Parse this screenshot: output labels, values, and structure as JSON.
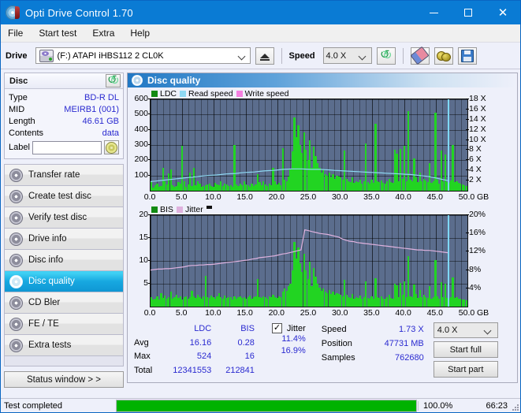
{
  "window": {
    "title": "Opti Drive Control 1.70",
    "icon": "disc-icon",
    "minimize": "minimize-icon",
    "maximize": "maximize-icon",
    "close": "✕"
  },
  "menu": [
    "File",
    "Start test",
    "Extra",
    "Help"
  ],
  "toolbar": {
    "drive_label": "Drive",
    "drive_value": "(F:)  ATAPI iHBS112  2 CL0K",
    "eject_icon": "eject-icon",
    "speed_label": "Speed",
    "speed_value": "4.0 X",
    "refresh_icon": "refresh-icon",
    "eraser_icon": "eraser-icon",
    "plug_icon": "plug-icon",
    "save_icon": "save-icon"
  },
  "disc": {
    "header": "Disc",
    "refresh_icon": "refresh-icon",
    "rows": [
      {
        "key": "Type",
        "value": "BD-R DL"
      },
      {
        "key": "MID",
        "value": "MEIRB1 (001)"
      },
      {
        "key": "Length",
        "value": "46.61 GB"
      },
      {
        "key": "Contents",
        "value": "data"
      }
    ],
    "label_key": "Label",
    "label_value": "",
    "cd_icon": "cd-icon"
  },
  "nav": {
    "items": [
      {
        "label": "Transfer rate",
        "active": false
      },
      {
        "label": "Create test disc",
        "active": false
      },
      {
        "label": "Verify test disc",
        "active": false
      },
      {
        "label": "Drive info",
        "active": false
      },
      {
        "label": "Disc info",
        "active": false
      },
      {
        "label": "Disc quality",
        "active": true
      },
      {
        "label": "CD Bler",
        "active": false
      },
      {
        "label": "FE / TE",
        "active": false
      },
      {
        "label": "Extra tests",
        "active": false
      }
    ],
    "status_button": "Status window > >"
  },
  "panel": {
    "title": "Disc quality",
    "icon": "disc-quality-icon"
  },
  "chart_data": [
    {
      "type": "bar",
      "id": "ldc-chart",
      "title": "",
      "legend": [
        {
          "label": "LDC",
          "color": "#128a12"
        },
        {
          "label": "Read speed",
          "color": "#8ed8f2"
        },
        {
          "label": "Write speed",
          "color": "#f57fe0"
        }
      ],
      "legend_position": "top-left",
      "xlabel": "GB",
      "x": [
        0.0,
        5.0,
        10.0,
        15.0,
        20.0,
        25.0,
        30.0,
        35.0,
        40.0,
        45.0,
        50.0
      ],
      "xlim": [
        0.0,
        50.0
      ],
      "ylabel": "",
      "yticks": [
        100,
        200,
        300,
        400,
        500,
        600
      ],
      "ylim": [
        0,
        600
      ],
      "y2ticks": [
        "2 X",
        "4 X",
        "6 X",
        "8 X",
        "10 X",
        "12 X",
        "14 X",
        "16 X",
        "18 X"
      ],
      "y2lim": [
        0,
        18
      ],
      "grid": true,
      "plot_bgcolor": "#5b6d8d",
      "series": [
        {
          "name": "LDC",
          "color": "#22d422",
          "type": "bar",
          "values": [
            60,
            20,
            35,
            45,
            25,
            30,
            150,
            60,
            40,
            115,
            140,
            35,
            25,
            30,
            55,
            45,
            295,
            60,
            25,
            40,
            120,
            30,
            150,
            35,
            60,
            45,
            25,
            30,
            35,
            40,
            45,
            30,
            25,
            50,
            40,
            35,
            60,
            30,
            45,
            40,
            30,
            35,
            25,
            300,
            40,
            30,
            45,
            35,
            60,
            40,
            35,
            25,
            45,
            30,
            40,
            110,
            55,
            35,
            60,
            40,
            30,
            45,
            35,
            150,
            60,
            40,
            50,
            35,
            280,
            70,
            60,
            95,
            140,
            260,
            480,
            350,
            430,
            300,
            250,
            385,
            270,
            200,
            330,
            150,
            290,
            230,
            180,
            150,
            120,
            140,
            110,
            100,
            120,
            90,
            110,
            80,
            100,
            95,
            90,
            70,
            265,
            80,
            60,
            55,
            90,
            50,
            60,
            55,
            70,
            45,
            60,
            310,
            55,
            45,
            70,
            50,
            440,
            60,
            55,
            65,
            50,
            45,
            60,
            75,
            55,
            50,
            270,
            245,
            60,
            275,
            80,
            295,
            60,
            520,
            70,
            60,
            210,
            90,
            55,
            120,
            60,
            80,
            65,
            55,
            180,
            50,
            60,
            510,
            70,
            45,
            265,
            60,
            240,
            55,
            50,
            65,
            300,
            55,
            60,
            50,
            45,
            40,
            35,
            30
          ]
        },
        {
          "name": "Read speed",
          "color": "#8ed8f2",
          "type": "line",
          "unit": "X",
          "values": [
            1.8,
            1.9,
            2.0,
            2.1,
            2.2,
            2.3,
            2.4,
            2.5,
            2.6,
            2.7,
            2.8,
            2.9,
            3.0,
            3.05,
            3.1,
            3.2,
            3.3,
            3.35,
            3.4,
            3.5,
            3.6,
            3.65,
            3.7,
            3.8,
            3.9,
            3.95,
            4.0,
            4.1,
            4.2,
            4.25,
            4.3,
            4.3,
            4.3,
            4.25,
            4.2,
            4.2,
            4.2,
            4.15,
            4.1,
            4.0,
            3.95,
            3.9,
            3.85,
            3.8,
            3.75,
            3.7,
            3.65,
            3.6,
            3.55,
            3.5,
            3.45,
            3.4,
            3.35,
            3.3,
            3.25,
            3.2,
            3.1,
            3.0,
            2.9,
            2.8,
            2.6,
            2.4,
            2.2,
            2.0
          ]
        }
      ],
      "cursor_x": 46.9
    },
    {
      "type": "bar",
      "id": "bis-chart",
      "title": "",
      "legend": [
        {
          "label": "BIS",
          "color": "#128a12"
        },
        {
          "label": "Jitter",
          "color": "#dfb2de"
        }
      ],
      "legend_position": "top-left",
      "xlabel": "GB",
      "x": [
        0.0,
        5.0,
        10.0,
        15.0,
        20.0,
        25.0,
        30.0,
        35.0,
        40.0,
        45.0,
        50.0
      ],
      "xlim": [
        0.0,
        50.0
      ],
      "yticks": [
        5,
        10,
        15,
        20
      ],
      "ylim": [
        0,
        20
      ],
      "y2ticks": [
        "4%",
        "8%",
        "12%",
        "16%",
        "20%"
      ],
      "y2lim": [
        0,
        20
      ],
      "grid": true,
      "plot_bgcolor": "#5b6d8d",
      "series": [
        {
          "name": "BIS",
          "color": "#22d422",
          "type": "bar",
          "values": [
            2.0,
            1.5,
            1.8,
            2.2,
            1.6,
            3.0,
            1.9,
            2.4,
            1.7,
            2.0,
            3.2,
            1.8,
            2.1,
            2.6,
            1.9,
            2.2,
            1.6,
            2.0,
            2.3,
            1.8,
            2.0,
            3.4,
            2.2,
            1.9,
            2.5,
            2.0,
            1.8,
            2.3,
            6.8,
            2.1,
            1.9,
            2.4,
            2.0,
            1.7,
            2.2,
            3.0,
            2.0,
            1.8,
            2.4,
            1.9,
            2.1,
            2.0,
            1.6,
            2.2,
            1.8,
            2.0,
            2.3,
            1.9,
            2.1,
            1.8,
            2.0,
            2.4,
            1.7,
            2.0,
            2.2,
            6.0,
            2.1,
            1.9,
            2.3,
            2.0,
            1.8,
            2.2,
            2.0,
            2.5,
            2.1,
            1.9,
            2.3,
            2.0,
            3.2,
            4.0,
            3.4,
            4.5,
            5.0,
            8.0,
            14.2,
            10.5,
            13.0,
            9.5,
            7.5,
            11.5,
            8.0,
            6.0,
            9.8,
            4.5,
            8.5,
            6.5,
            5.0,
            4.2,
            3.5,
            4.0,
            3.2,
            3.0,
            3.6,
            2.8,
            3.3,
            2.5,
            3.0,
            2.8,
            2.6,
            2.2,
            5.8,
            2.5,
            2.0,
            1.9,
            2.8,
            1.8,
            2.0,
            1.9,
            2.4,
            1.7,
            2.0,
            5.5,
            1.9,
            1.7,
            2.3,
            1.8,
            6.2,
            2.0,
            1.9,
            2.2,
            1.8,
            1.7,
            2.0,
            2.5,
            1.9,
            1.8,
            5.0,
            4.6,
            2.0,
            5.2,
            2.6,
            5.5,
            2.0,
            11.0,
            2.3,
            2.0,
            4.8,
            2.8,
            1.9,
            3.6,
            2.0,
            2.6,
            2.1,
            1.9,
            4.4,
            1.8,
            2.0,
            10.1,
            2.3,
            1.7,
            5.4,
            2.0,
            5.0,
            1.9,
            1.8,
            2.1,
            6.4,
            1.9,
            2.0,
            1.8,
            1.7,
            1.6,
            1.5,
            1.4
          ]
        },
        {
          "name": "Jitter",
          "color": "#dfb2de",
          "type": "line",
          "unit": "%",
          "values": [
            8.0,
            8.1,
            8.2,
            8.2,
            8.3,
            8.3,
            8.4,
            8.5,
            8.6,
            8.7,
            8.9,
            9.0,
            9.0,
            9.1,
            9.1,
            9.2,
            9.2,
            9.3,
            9.4,
            9.5,
            9.6,
            9.7,
            9.8,
            9.9,
            10.0,
            10.1,
            10.2,
            10.4,
            10.5,
            10.7,
            10.8,
            10.9,
            11.0,
            11.1,
            11.3,
            11.5,
            11.6,
            11.8,
            12.0,
            12.2,
            12.4,
            16.8,
            16.6,
            16.4,
            16.2,
            16.0,
            15.9,
            15.8,
            15.6,
            15.4,
            15.2,
            14.8,
            14.5,
            14.3,
            14.2,
            14.0,
            13.9,
            13.8,
            13.7,
            13.6,
            13.5,
            13.4,
            13.3,
            13.2,
            13.1,
            13.0,
            12.9,
            12.8,
            12.7,
            12.6,
            12.5,
            12.4,
            12.4,
            12.3,
            12.3,
            12.2,
            12.1,
            12.0,
            11.9,
            11.8
          ]
        }
      ],
      "cursor_x": 46.9
    }
  ],
  "stats": {
    "columns": [
      "LDC",
      "BIS"
    ],
    "rows": [
      {
        "key": "Avg",
        "ldc": "16.16",
        "bis": "0.28",
        "jitter": "11.4%"
      },
      {
        "key": "Max",
        "ldc": "524",
        "bis": "16",
        "jitter": "16.9%"
      },
      {
        "key": "Total",
        "ldc": "12341553",
        "bis": "212841",
        "jitter": ""
      }
    ],
    "jitter_label": "Jitter",
    "jitter_checked": true,
    "jitter_check_glyph": "✓",
    "speed_key": "Speed",
    "speed_value": "1.73 X",
    "position_key": "Position",
    "position_value": "47731 MB",
    "samples_key": "Samples",
    "samples_value": "762680",
    "speed_combo": "4.0 X",
    "start_full": "Start full",
    "start_part": "Start part"
  },
  "statusbar": {
    "message": "Test completed",
    "progress_percent": 100,
    "progress_text": "100.0%",
    "elapsed": "66:23"
  }
}
